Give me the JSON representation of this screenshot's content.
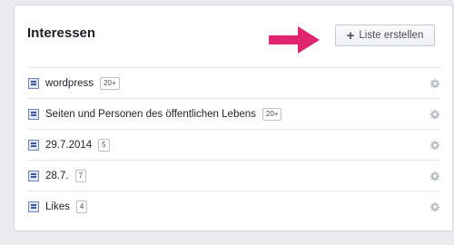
{
  "panel": {
    "title": "Interessen",
    "create_button": {
      "icon": "plus-icon",
      "label": "Liste erstellen"
    },
    "pointer_arrow": {
      "icon": "arrow-right-icon",
      "color": "#e0246f"
    }
  },
  "lists": [
    {
      "label": "wordpress",
      "badge": "20+",
      "icon": "list-icon",
      "settings_icon": "gear-icon"
    },
    {
      "label": "Seiten und Personen des öffentlichen Lebens",
      "badge": "20+",
      "icon": "list-icon",
      "settings_icon": "gear-icon"
    },
    {
      "label": "29.7.2014",
      "badge": "5",
      "icon": "list-icon",
      "settings_icon": "gear-icon"
    },
    {
      "label": "28.7.",
      "badge": "7",
      "icon": "list-icon",
      "settings_icon": "gear-icon"
    },
    {
      "label": "Likes",
      "badge": "4",
      "icon": "list-icon",
      "settings_icon": "gear-icon"
    }
  ]
}
